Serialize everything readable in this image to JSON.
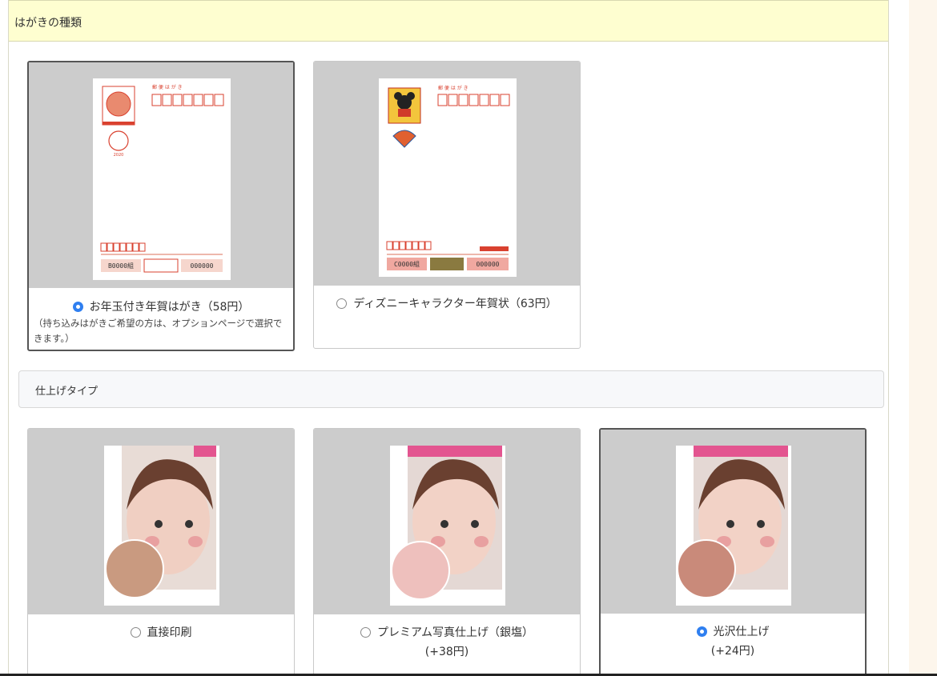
{
  "card_type_section": {
    "title": "はがきの種類",
    "options": [
      {
        "label": "お年玉付き年賀はがき（58円）",
        "note": "（持ち込みはがきご希望の方は、オプションページで選択できます。）",
        "selected": true,
        "postcard": {
          "header": "郵 便 は が き",
          "year": "2020",
          "lottery_number": "B0000組",
          "lottery_serial": "000000"
        }
      },
      {
        "label": "ディズニーキャラクター年賀状（63円）",
        "selected": false,
        "postcard": {
          "header": "郵 便 は が き",
          "lottery_number": "C0000組",
          "lottery_serial": "000000"
        }
      }
    ]
  },
  "finish_section": {
    "title": "仕上げタイプ",
    "options": [
      {
        "label": "直接印刷",
        "price": "",
        "selected": false
      },
      {
        "label": "プレミアム写真仕上げ（銀塩）",
        "price": "(+38円)",
        "selected": false
      },
      {
        "label": "光沢仕上げ",
        "price": "(+24円)",
        "selected": true
      }
    ]
  },
  "colors": {
    "header_bg": "#fefed0",
    "radio_selected": "#2f7ff0",
    "thumb_bg": "#cccccc",
    "postal_red": "#d9412f"
  }
}
